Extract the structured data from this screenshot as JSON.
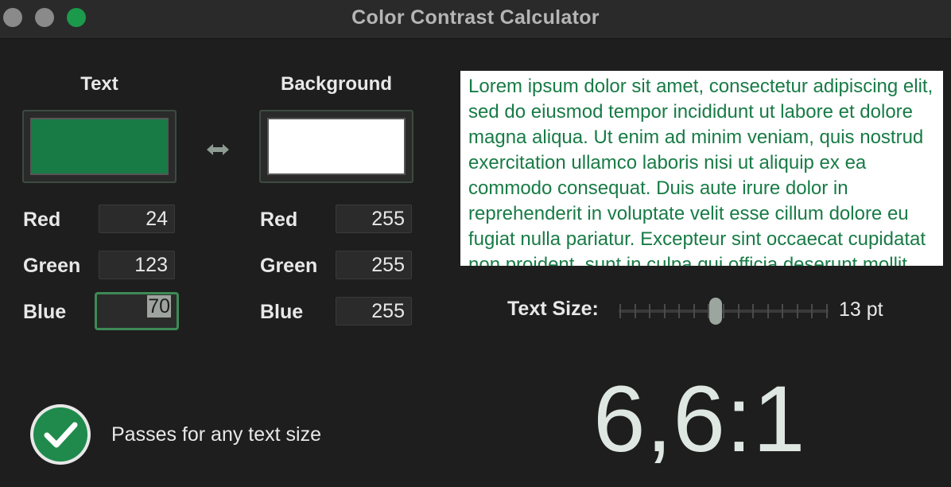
{
  "window": {
    "title": "Color Contrast Calculator"
  },
  "text_color": {
    "heading": "Text",
    "swatch_hex": "#187b46",
    "red_label": "Red",
    "red": "24",
    "green_label": "Green",
    "green": "123",
    "blue_label": "Blue",
    "blue": "70"
  },
  "background_color": {
    "heading": "Background",
    "swatch_hex": "#ffffff",
    "red_label": "Red",
    "red": "255",
    "green_label": "Green",
    "green": "255",
    "blue_label": "Blue",
    "blue": "255"
  },
  "icons": {
    "swap": "swap-arrows-icon",
    "pass": "checkmark-circle-icon"
  },
  "preview": {
    "text": "Lorem ipsum dolor sit amet, consectetur adipiscing elit, sed do eiusmod tempor incididunt ut labore et dolore magna aliqua. Ut enim ad minim veniam, quis nostrud exercitation ullamco laboris nisi ut aliquip ex ea commodo consequat. Duis aute irure dolor in reprehenderit in voluptate velit esse cillum dolore eu fugiat nulla pariatur. Excepteur sint occaecat cupidatat non proident, sunt in culpa qui officia deserunt mollit anim id est laborum."
  },
  "text_size": {
    "label": "Text Size:",
    "value_label": "13 pt",
    "slider_fraction": 0.46,
    "tick_count": 15
  },
  "result": {
    "ratio": "6,6:1",
    "status": "Passes for any text size",
    "status_color": "#1f8a4c"
  },
  "colors": {
    "accent": "#1b9a4b"
  }
}
